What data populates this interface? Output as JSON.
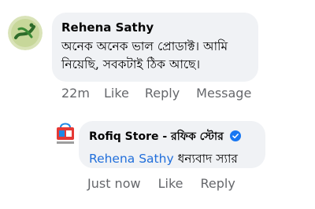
{
  "comments": [
    {
      "author": "Rehena Sathy",
      "text_line1": "অনেক অনেক ভাল প্রোডাক্ট। আমি",
      "text_line2": "নিয়েছি, সবকটাই ঠিক আছে।",
      "time": "22m",
      "like_label": "Like",
      "reply_label": "Reply",
      "message_label": "Message"
    }
  ],
  "reply": {
    "author": "Rofiq Store - রফিক স্টোর",
    "verified_icon": "verified-badge-icon",
    "mention": "Rehena Sathy",
    "text": "ধন্যবাদ স্যার",
    "time": "Just now",
    "like_label": "Like",
    "reply_label": "Reply"
  },
  "colors": {
    "bubble": "#f0f2f5",
    "action_text": "#65676b",
    "mention": "#216fdb",
    "verified": "#1877f2"
  }
}
